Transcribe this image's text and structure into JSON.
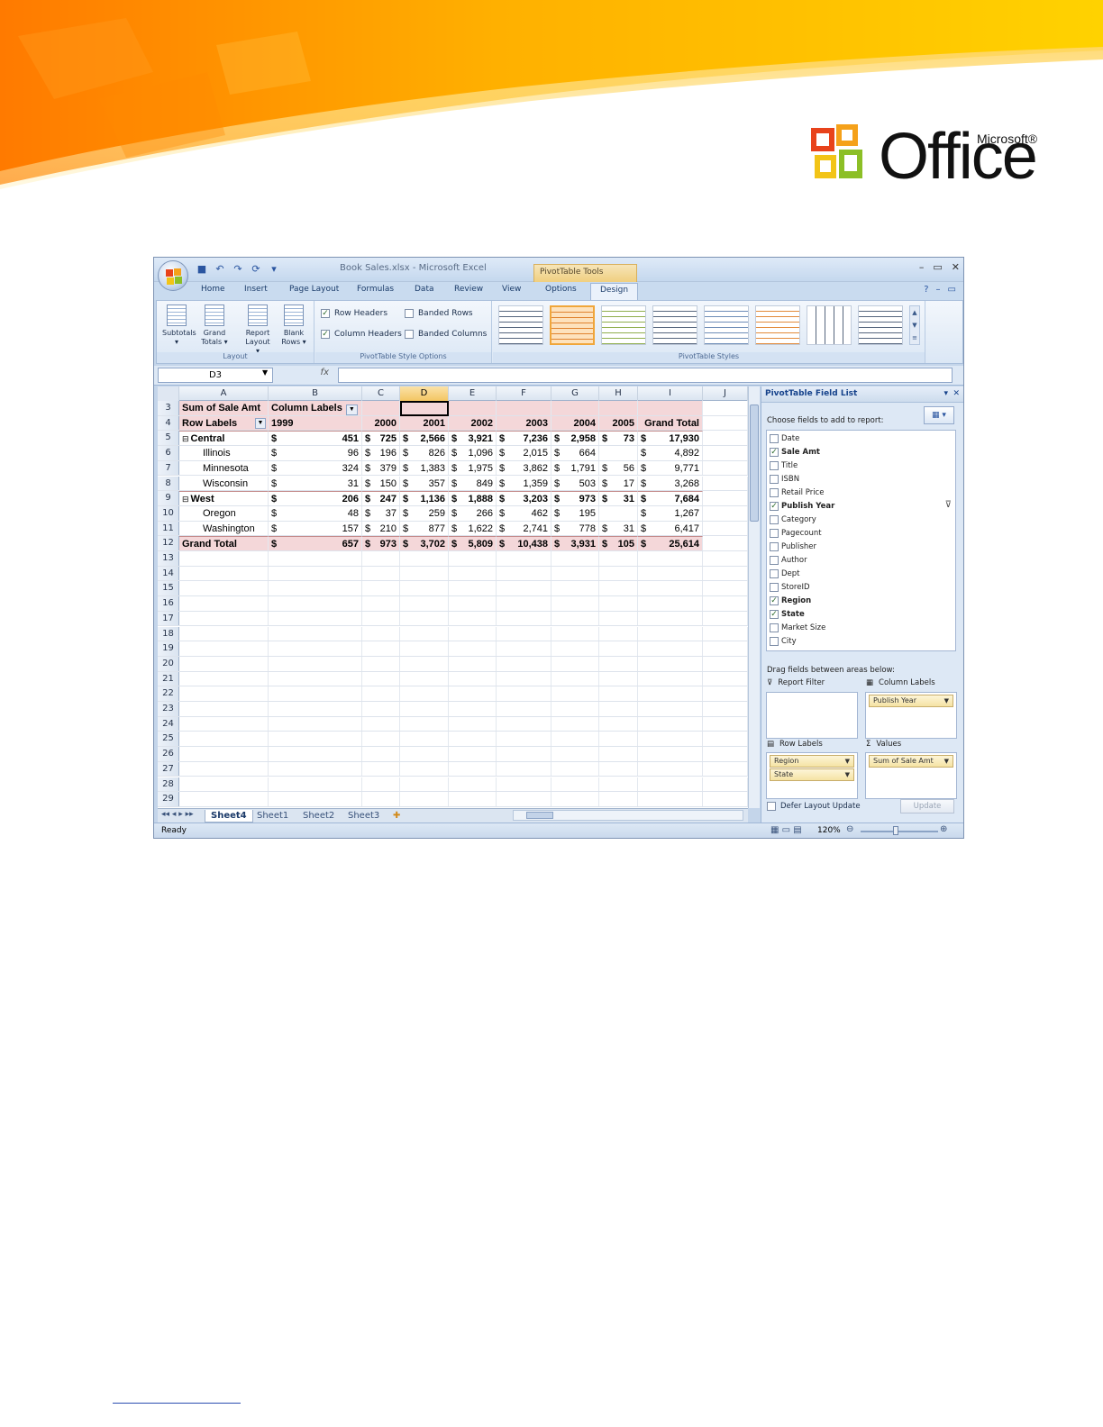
{
  "brand": {
    "logo_word": "Office",
    "logo_super": "Microsoft®",
    "logo_reg": "®"
  },
  "window": {
    "title": "Book Sales.xlsx - Microsoft Excel",
    "context_tab_group": "PivotTable Tools",
    "controls": [
      "–",
      "▭",
      "✕"
    ]
  },
  "ribbon_tabs": [
    "Home",
    "Insert",
    "Page Layout",
    "Formulas",
    "Data",
    "Review",
    "View",
    "Options",
    "Design"
  ],
  "active_tab": "Design",
  "ribbon": {
    "layout": {
      "label": "Layout",
      "buttons": [
        {
          "label": "Subtotals",
          "sub": "▾"
        },
        {
          "label": "Grand",
          "sub": "Totals ▾"
        },
        {
          "label": "Report",
          "sub": "Layout ▾"
        },
        {
          "label": "Blank",
          "sub": "Rows ▾"
        }
      ]
    },
    "style_options": {
      "label": "PivotTable Style Options",
      "row_headers": "Row Headers",
      "column_headers": "Column Headers",
      "banded_rows": "Banded Rows",
      "banded_columns": "Banded Columns",
      "row_headers_checked": true,
      "column_headers_checked": true,
      "banded_rows_checked": false,
      "banded_columns_checked": false
    },
    "styles": {
      "label": "PivotTable Styles",
      "count": 8,
      "selected_index": 1
    }
  },
  "formula_bar": {
    "name_box": "D3",
    "fx": "fx",
    "value": ""
  },
  "columns": [
    "A",
    "B",
    "C",
    "D",
    "E",
    "F",
    "G",
    "H",
    "I",
    "J"
  ],
  "selected_column": "D",
  "rows": [
    {
      "n": "3",
      "cells": [
        "Sum of Sale Amt",
        "Column Labels",
        "",
        "",
        "",
        "",
        "",
        "",
        "",
        ""
      ]
    },
    {
      "n": "4",
      "cells": [
        "Row Labels",
        "1999",
        "2000",
        "2001",
        "2002",
        "2003",
        "2004",
        "2005",
        "Grand Total",
        ""
      ]
    },
    {
      "n": "5",
      "cells": [
        "Central",
        "$ 451",
        "$ 725",
        "$ 2,566",
        "$ 3,921",
        "$ 7,236",
        "$ 2,958",
        "$ 73",
        "$ 17,930",
        ""
      ]
    },
    {
      "n": "6",
      "cells": [
        "Illinois",
        "$ 96",
        "$ 196",
        "$ 826",
        "$ 1,096",
        "$ 2,015",
        "$ 664",
        "",
        "$ 4,892",
        ""
      ]
    },
    {
      "n": "7",
      "cells": [
        "Minnesota",
        "$ 324",
        "$ 379",
        "$ 1,383",
        "$ 1,975",
        "$ 3,862",
        "$ 1,791",
        "$ 56",
        "$ 9,771",
        ""
      ]
    },
    {
      "n": "8",
      "cells": [
        "Wisconsin",
        "$ 31",
        "$ 150",
        "$ 357",
        "$ 849",
        "$ 1,359",
        "$ 503",
        "$ 17",
        "$ 3,268",
        ""
      ]
    },
    {
      "n": "9",
      "cells": [
        "West",
        "$ 206",
        "$ 247",
        "$ 1,136",
        "$ 1,888",
        "$ 3,203",
        "$ 973",
        "$ 31",
        "$ 7,684",
        ""
      ]
    },
    {
      "n": "10",
      "cells": [
        "Oregon",
        "$ 48",
        "$ 37",
        "$ 259",
        "$ 266",
        "$ 462",
        "$ 195",
        "",
        "$ 1,267",
        ""
      ]
    },
    {
      "n": "11",
      "cells": [
        "Washington",
        "$ 157",
        "$ 210",
        "$ 877",
        "$ 1,622",
        "$ 2,741",
        "$ 778",
        "$ 31",
        "$ 6,417",
        ""
      ]
    },
    {
      "n": "12",
      "cells": [
        "Grand Total",
        "$ 657",
        "$ 973",
        "$ 3,702",
        "$ 5,809",
        "$ 10,438",
        "$ 3,931",
        "$ 105",
        "$ 25,614",
        ""
      ]
    },
    {
      "n": "13",
      "cells": []
    },
    {
      "n": "14",
      "cells": []
    },
    {
      "n": "15",
      "cells": []
    },
    {
      "n": "16",
      "cells": []
    },
    {
      "n": "17",
      "cells": []
    },
    {
      "n": "18",
      "cells": []
    },
    {
      "n": "19",
      "cells": []
    },
    {
      "n": "20",
      "cells": []
    },
    {
      "n": "21",
      "cells": []
    },
    {
      "n": "22",
      "cells": []
    },
    {
      "n": "23",
      "cells": []
    },
    {
      "n": "24",
      "cells": []
    },
    {
      "n": "25",
      "cells": []
    },
    {
      "n": "26",
      "cells": []
    },
    {
      "n": "27",
      "cells": []
    },
    {
      "n": "28",
      "cells": []
    },
    {
      "n": "29",
      "cells": []
    }
  ],
  "sheet_tabs": [
    "Sheet4",
    "Sheet1",
    "Sheet2",
    "Sheet3"
  ],
  "active_sheet": "Sheet4",
  "status": {
    "left": "Ready",
    "zoom": "120%"
  },
  "field_list": {
    "title": "PivotTable Field List",
    "choose_label": "Choose fields to add to report:",
    "fields": [
      {
        "name": "Date",
        "checked": false
      },
      {
        "name": "Sale Amt",
        "checked": true
      },
      {
        "name": "Title",
        "checked": false
      },
      {
        "name": "ISBN",
        "checked": false
      },
      {
        "name": "Retail Price",
        "checked": false
      },
      {
        "name": "Publish Year",
        "checked": true,
        "filtered": true
      },
      {
        "name": "Category",
        "checked": false
      },
      {
        "name": "Pagecount",
        "checked": false
      },
      {
        "name": "Publisher",
        "checked": false
      },
      {
        "name": "Author",
        "checked": false
      },
      {
        "name": "Dept",
        "checked": false
      },
      {
        "name": "StoreID",
        "checked": false
      },
      {
        "name": "Region",
        "checked": true
      },
      {
        "name": "State",
        "checked": true
      },
      {
        "name": "Market Size",
        "checked": false
      },
      {
        "name": "City",
        "checked": false
      }
    ],
    "drag_label": "Drag fields between areas below:",
    "report_filter": "Report Filter",
    "column_labels": "Column Labels",
    "row_labels": "Row Labels",
    "values": "Values",
    "column_label_items": [
      "Publish Year"
    ],
    "row_label_items": [
      "Region",
      "State"
    ],
    "value_items": [
      "Sum of Sale Amt"
    ],
    "defer_label": "Defer Layout Update",
    "update_label": "Update"
  }
}
